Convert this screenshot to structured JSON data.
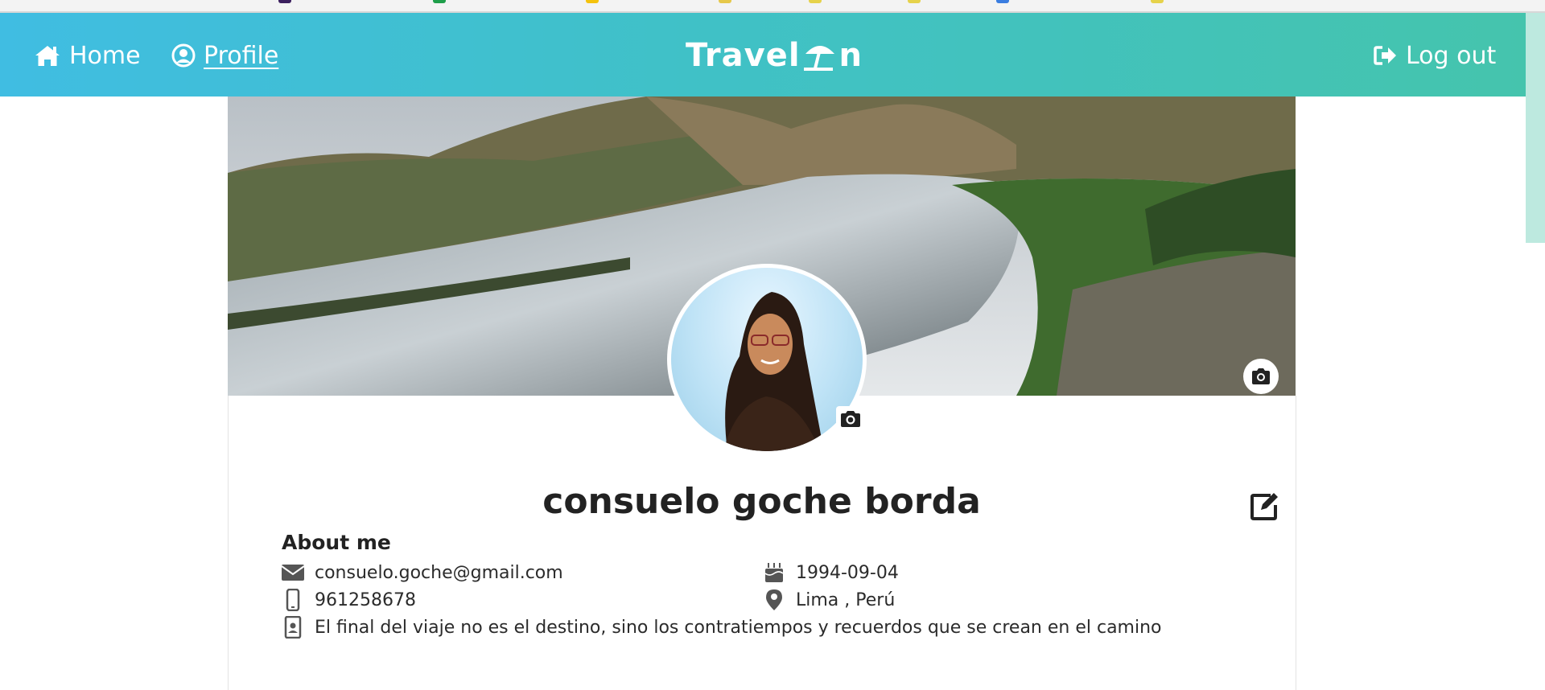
{
  "nav": {
    "home_label": "Home",
    "profile_label": "Profile",
    "brand_left": "Travel",
    "brand_right": "n",
    "logout_label": "Log out",
    "gradient_start": "#40bde2",
    "gradient_end": "#45c4ad"
  },
  "profile": {
    "name": "consuelo goche borda",
    "about_title": "About me",
    "email": "consuelo.goche@gmail.com",
    "phone": "961258678",
    "bio": "El final del viaje no es el destino, sino los contratiempos y recuerdos que se crean en el camino",
    "birthdate": "1994-09-04",
    "location": "Lima , Perú"
  },
  "icons": {
    "home": "home-icon",
    "profile": "user-circle-icon",
    "logout": "sign-out-icon",
    "brand": "beach-umbrella-icon",
    "cover_camera": "camera-icon",
    "avatar_camera": "camera-icon",
    "edit": "edit-icon",
    "email": "envelope-icon",
    "phone": "mobile-phone-icon",
    "bio": "id-badge-icon",
    "birthdate": "birthday-cake-icon",
    "location": "map-marker-icon"
  }
}
